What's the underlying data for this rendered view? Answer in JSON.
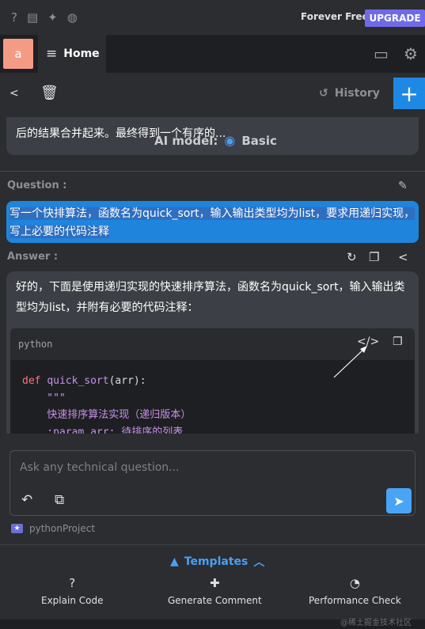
{
  "topbar": {
    "icons": [
      "help-icon",
      "chat-icon",
      "twitter-icon",
      "globe-icon"
    ],
    "plan_text": "Forever Free",
    "upgrade_label": "UPGRADE",
    "upgrade_color": "#6f6ae8"
  },
  "tabs": {
    "avatar_letter": "a",
    "home_label": "Home"
  },
  "toolbar": {
    "history_label": "History",
    "plus_label": "+",
    "accent_color": "#1e88e5"
  },
  "previous_answer": {
    "text": "后的结果合并起来。最终得到一个有序的...",
    "ai_model_label": "AI model:",
    "ai_model_value": "Basic"
  },
  "question": {
    "label": "Question :",
    "text": "写一个快排算法，函数名为quick_sort，输入输出类型均为list，要求用递归实现，写上必要的代码注释"
  },
  "answer": {
    "label": "Answer :",
    "intro": "好的，下面是使用递归实现的快速排序算法，函数名为quick_sort，输入输出类型均为list，并附有必要的代码注释：",
    "code_lang": "python",
    "code_lines": {
      "l1_kw": "def",
      "l1_fn": "quick_sort",
      "l1_rest": "(arr):",
      "l2": "    \"\"\"",
      "l3": "    快速排序算法实现（递归版本）",
      "l4": "    :param arr: 待排序的列表"
    }
  },
  "input": {
    "placeholder": "Ask any technical question..."
  },
  "project": {
    "name": "pythonProject"
  },
  "bottom": {
    "templates_label": "Templates",
    "actions": [
      {
        "label": "Explain Code",
        "icon": "help-circle-icon"
      },
      {
        "label": "Generate Comment",
        "icon": "comment-plus-icon"
      },
      {
        "label": "Performance Check",
        "icon": "gauge-icon"
      }
    ]
  },
  "watermark": "@稀土掘金技术社区"
}
